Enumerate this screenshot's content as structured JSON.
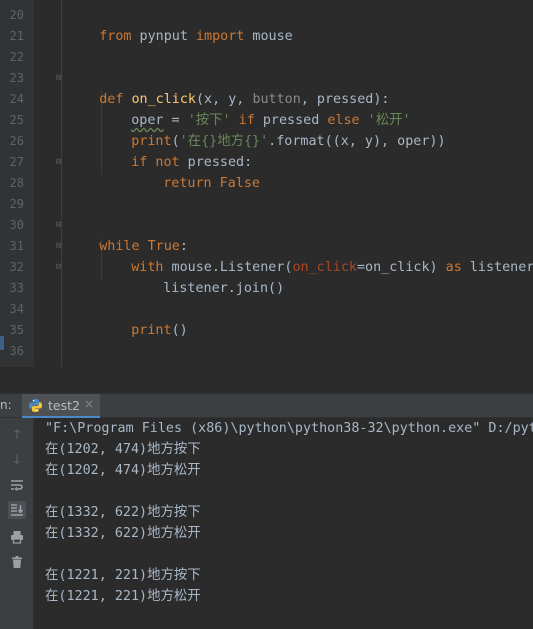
{
  "editor": {
    "line_numbers": [
      "20",
      "21",
      "22",
      "23",
      "24",
      "25",
      "26",
      "27",
      "28",
      "29",
      "30",
      "31",
      "32",
      "33",
      "34",
      "35",
      "36"
    ],
    "l20": {
      "kw1": "from",
      "mod": " pynput ",
      "kw2": "import",
      "name": " mouse"
    },
    "l23": {
      "kw": "def",
      "fn": "on_click",
      "open": "(x, y, ",
      "button": "button",
      "rest": ", pressed):"
    },
    "l24": {
      "var": "oper",
      "eq": " = ",
      "s1": "'按下'",
      "kw_if": " if ",
      "cond": "pressed",
      "kw_else": " else ",
      "s2": "'松开'"
    },
    "l25": {
      "fn": "print",
      "open": "(",
      "s": "'在{}地方{}'",
      "rest": ".format((x, y), oper))"
    },
    "l26": {
      "kw": "if not",
      "rest": " pressed:"
    },
    "l27": {
      "kw": "return False"
    },
    "l30": {
      "kw": "while",
      "sp": " ",
      "val": "True",
      "colon": ":"
    },
    "l31": {
      "kw": "with",
      "a": " mouse.Listener(",
      "named": "on_click",
      "b": "=on_click)",
      "kw_as": " as",
      "c": " listener:"
    },
    "l32": {
      "text": "listener.join()"
    },
    "l34": {
      "fn": "print",
      "rest": "()"
    }
  },
  "run_panel": {
    "label": "n:",
    "tab_title": "test2",
    "tab_close": "×",
    "toolbar_icons": [
      "arrow-up-icon",
      "arrow-down-icon",
      "soft-wrap-icon",
      "scroll-to-end-icon",
      "print-icon",
      "trash-icon"
    ],
    "output": [
      "\"F:\\Program Files (x86)\\python\\python38-32\\python.exe\" D:/pyt",
      "在(1202, 474)地方按下",
      "在(1202, 474)地方松开",
      "",
      "在(1332, 622)地方按下",
      "在(1332, 622)地方松开",
      "",
      "在(1221, 221)地方按下",
      "在(1221, 221)地方松开"
    ]
  },
  "colors": {
    "background": "#2b2b2b",
    "keyword": "#cc7832",
    "function": "#ffc66d",
    "string": "#6a8759",
    "text": "#a9b7c6",
    "tab_underline": "#4a88c7"
  }
}
